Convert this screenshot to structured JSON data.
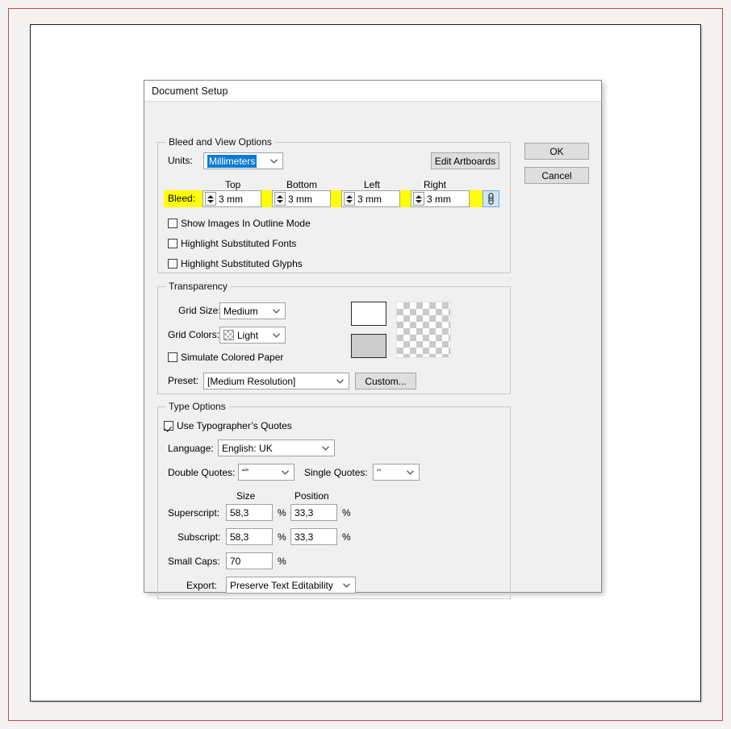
{
  "dialog": {
    "title": "Document Setup"
  },
  "buttons": {
    "ok": "OK",
    "cancel": "Cancel",
    "edit_artboards": "Edit Artboards",
    "custom": "Custom..."
  },
  "bleed_group": {
    "legend": "Bleed and View Options",
    "units_label": "Units:",
    "units_value": "Millimeters",
    "bleed_label": "Bleed:",
    "col_top": "Top",
    "col_bottom": "Bottom",
    "col_left": "Left",
    "col_right": "Right",
    "bleed_top": "3 mm",
    "bleed_bottom": "3 mm",
    "bleed_left": "3 mm",
    "bleed_right": "3 mm",
    "link_icon": "chain-link-icon",
    "checkboxes": [
      {
        "label": "Show Images In Outline Mode",
        "checked": false
      },
      {
        "label": "Highlight Substituted Fonts",
        "checked": false
      },
      {
        "label": "Highlight Substituted Glyphs",
        "checked": false
      }
    ]
  },
  "transparency_group": {
    "legend": "Transparency",
    "grid_size_label": "Grid Size:",
    "grid_size_value": "Medium",
    "grid_colors_label": "Grid Colors:",
    "grid_colors_value": "Light",
    "simulate_label": "Simulate Colored Paper",
    "simulate_checked": false,
    "preset_label": "Preset:",
    "preset_value": "[Medium Resolution]",
    "swatch_top_color": "#ffffff",
    "swatch_bottom_color": "#cccccc"
  },
  "type_group": {
    "legend": "Type Options",
    "typographers_quotes_label": "Use Typographer’s Quotes",
    "typographers_quotes_checked": true,
    "language_label": "Language:",
    "language_value": "English: UK",
    "double_quotes_label": "Double Quotes:",
    "double_quotes_value": "“”",
    "single_quotes_label": "Single Quotes:",
    "single_quotes_value": "‘’",
    "col_size": "Size",
    "col_position": "Position",
    "superscript_label": "Superscript:",
    "superscript_size": "58,3",
    "superscript_position": "33,3",
    "subscript_label": "Subscript:",
    "subscript_size": "58,3",
    "subscript_position": "33,3",
    "smallcaps_label": "Small Caps:",
    "smallcaps_size": "70",
    "export_label": "Export:",
    "export_value": "Preserve Text Editability",
    "percent": "%"
  },
  "colors": {
    "highlight": "#ffff00",
    "selection_blue": "#0b7bd4",
    "frame_red": "#c14a4a",
    "dialog_bg": "#f0f0f0"
  }
}
